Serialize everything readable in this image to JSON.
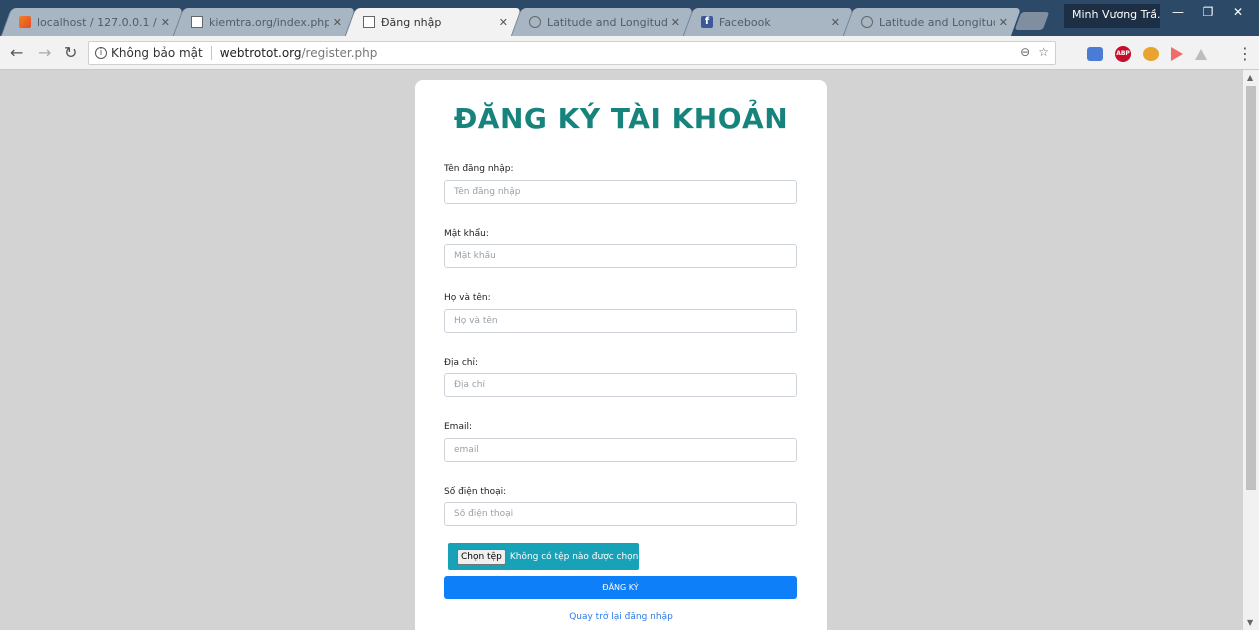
{
  "browser": {
    "tabs": [
      {
        "title": "localhost / 127.0.0.1 /",
        "icon": "xampp-icon",
        "active": false
      },
      {
        "title": "kiemtra.org/index.php",
        "icon": "document-icon",
        "active": false
      },
      {
        "title": "Đăng nhập",
        "icon": "document-icon",
        "active": true
      },
      {
        "title": "Latitude and Longitude",
        "icon": "compass-icon",
        "active": false
      },
      {
        "title": "Facebook",
        "icon": "facebook-icon",
        "active": false
      },
      {
        "title": "Latitude and Longitude",
        "icon": "compass-icon",
        "active": false
      }
    ],
    "profile_name": "Minh Vương Trầ...",
    "security_label": "Không bảo mật",
    "url_host": "webtrotot.org",
    "url_path": "/register.php"
  },
  "form": {
    "title": "ĐĂNG KÝ TÀI KHOẢN",
    "fields": [
      {
        "label": "Tên đăng nhập:",
        "placeholder": "Tên đăng nhập"
      },
      {
        "label": "Mật khẩu:",
        "placeholder": "Mật khẩu"
      },
      {
        "label": "Họ và tên:",
        "placeholder": "Họ và tên"
      },
      {
        "label": "Địa chỉ:",
        "placeholder": "Địa chỉ"
      },
      {
        "label": "Email:",
        "placeholder": "email"
      },
      {
        "label": "Số điện thoại:",
        "placeholder": "Số điện thoại"
      }
    ],
    "file_button": "Chọn tệp",
    "file_status": "Không có tệp nào được chọn",
    "submit_label": "ĐĂNG KÝ",
    "back_link": "Quay trở lại đăng nhập"
  },
  "colors": {
    "title": "#16847c",
    "submit": "#0d7ff9",
    "file_bg": "#17a2b8",
    "page_bg": "#d3d3d3"
  }
}
